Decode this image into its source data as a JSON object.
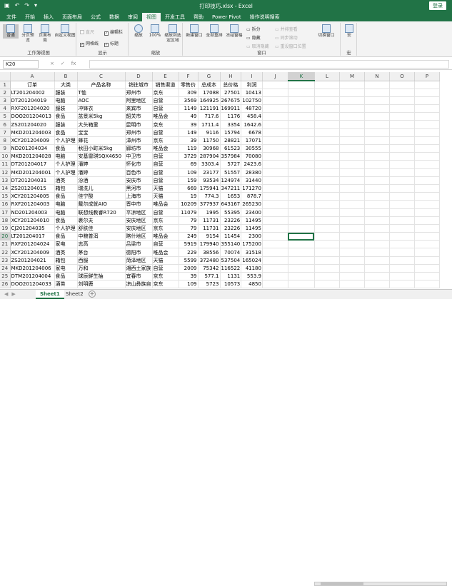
{
  "window": {
    "title": "打印技巧.xlsx - Excel",
    "login": "登录"
  },
  "menu": {
    "tabs": [
      "文件",
      "开始",
      "插入",
      "页面布局",
      "公式",
      "数据",
      "审阅",
      "视图",
      "开发工具",
      "帮助",
      "Power Pivot",
      "操作说明搜索"
    ],
    "active": 7
  },
  "ribbon": {
    "views": {
      "normal": "普通",
      "page_break": "分页预览",
      "page_layout": "页面布局",
      "custom": "自定义视图",
      "label": "工作簿视图"
    },
    "show": {
      "ruler": "直尺",
      "formula_bar": "编辑栏",
      "gridlines": "网格线",
      "headings": "标题",
      "label": "显示"
    },
    "zoom": {
      "zoom": "缩放",
      "zoom100": "100%",
      "zoom_sel": "缩放到选定区域",
      "label": "缩放"
    },
    "window": {
      "new": "新建窗口",
      "arrange": "全部重排",
      "freeze": "冻结窗格",
      "split": "拆分",
      "hide": "隐藏",
      "unhide": "取消隐藏",
      "side": "并排查看",
      "sync": "同步滚动",
      "reset": "重设窗口位置",
      "switch": "切换窗口",
      "label": "窗口"
    },
    "macro": {
      "macro": "宏",
      "label": "宏"
    }
  },
  "formula": {
    "namebox": "K20",
    "cancel": "×",
    "enter": "✓",
    "fx": "fx",
    "value": ""
  },
  "grid": {
    "columns": [
      "A",
      "B",
      "C",
      "D",
      "E",
      "F",
      "G",
      "H",
      "I",
      "J",
      "K",
      "L",
      "M",
      "N",
      "O",
      "P"
    ],
    "selected_cell": "K20",
    "rows": [
      [
        "订单",
        "大类",
        "产品名称",
        "销往城市",
        "销售渠道",
        "零售价",
        "总成本",
        "总价格",
        "利润"
      ],
      [
        "LT201204002",
        "服装",
        "T恤",
        "郑州市",
        "京东",
        "309",
        "17088",
        "27501",
        "10413"
      ],
      [
        "DT201204019",
        "电脑",
        "AOC",
        "阿里地区",
        "自营",
        "3569",
        "164925",
        "267675",
        "102750"
      ],
      [
        "RXF201204020",
        "服装",
        "冲锋衣",
        "来宾市",
        "自营",
        "1149",
        "121191",
        "169911",
        "48720"
      ],
      [
        "DOO201204013",
        "食品",
        "盆景米5kg",
        "韶关市",
        "唯品会",
        "49",
        "717.6",
        "1176",
        "458.4"
      ],
      [
        "ZS201204020",
        "服装",
        "大头箱里",
        "昆明市",
        "京东",
        "39",
        "1711.4",
        "3354",
        "1642.6"
      ],
      [
        "MKD201204003",
        "食品",
        "宝宝",
        "郑州市",
        "自营",
        "149",
        "9116",
        "15794",
        "6678"
      ],
      [
        "XCY201204009",
        "个人护理",
        "蜂花",
        "漳州市",
        "京东",
        "39",
        "11750",
        "28821",
        "17071"
      ],
      [
        "ND201204034",
        "食品",
        "秋田小町米5kg",
        "廊坊市",
        "唯品会",
        "119",
        "30968",
        "61523",
        "30555"
      ],
      [
        "MKD201204028",
        "电脑",
        "安基雷琪SQX4650",
        "中卫市",
        "自营",
        "3729",
        "287904",
        "357984",
        "70080"
      ],
      [
        "DT201204017",
        "个人护理",
        "潘婷",
        "怀化市",
        "自营",
        "69",
        "3303.4",
        "5727",
        "2423.6"
      ],
      [
        "MKD201204001",
        "个人护理",
        "潘婷",
        "百色市",
        "自营",
        "109",
        "23177",
        "51557",
        "28380"
      ],
      [
        "DT201204031",
        "酒类",
        "汾酒",
        "安庆市",
        "自营",
        "159",
        "93534",
        "124974",
        "31440"
      ],
      [
        "ZS201204015",
        "箱包",
        "瑞洗儿",
        "黑河市",
        "天猫",
        "669",
        "175941",
        "347211",
        "171270"
      ],
      [
        "XCY201204005",
        "食品",
        "佳宁酸",
        "上海市",
        "天猫",
        "19",
        "774.3",
        "1653",
        "878.7"
      ],
      [
        "RXF201204003",
        "电脑",
        "戴尔成就AIO",
        "晋中市",
        "唯品会",
        "10209",
        "377937",
        "643167",
        "265230"
      ],
      [
        "ND201204003",
        "电脑",
        "联想线教睿R720",
        "平凉地区",
        "自营",
        "11079",
        "1995",
        "55395",
        "23400"
      ],
      [
        "XCY201204010",
        "食品",
        "裹尔夫",
        "安庆地区",
        "京东",
        "79",
        "11731",
        "23226",
        "11495"
      ],
      [
        "CJ201204035",
        "个人护理",
        "舒肤佳",
        "安庆地区",
        "京东",
        "79",
        "11731",
        "23226",
        "11495"
      ],
      [
        "LT201204017",
        "食品",
        "中粮普洱",
        "喀什地区",
        "唯品会",
        "249",
        "9154",
        "11454",
        "2300"
      ],
      [
        "RXF201204024",
        "家电",
        "志高",
        "吕梁市",
        "自营",
        "5919",
        "179940",
        "355140",
        "175200"
      ],
      [
        "XCY201204009",
        "酒类",
        "茅台",
        "德阳市",
        "唯品会",
        "229",
        "38556",
        "70074",
        "31518"
      ],
      [
        "ZS201204021",
        "箱包",
        "西服",
        "菏泽地区",
        "天猫",
        "5599",
        "372480",
        "537504",
        "165024"
      ],
      [
        "MKD201204006",
        "家电",
        "万和",
        "湘西土家族",
        "自营",
        "2009",
        "75342",
        "116522",
        "41180"
      ],
      [
        "DTM201204004",
        "食品",
        "球辰鲜生抽",
        "宜春市",
        "京东",
        "39",
        "577.1",
        "1131",
        "553.9"
      ],
      [
        "DOO201204033",
        "酒类",
        "刘明鹿",
        "凉山彝族自",
        "京东",
        "109",
        "5723",
        "10573",
        "4850"
      ],
      [
        "DT201204014",
        "酒类",
        "刘明鹿",
        "衢州市",
        "天猫",
        "479",
        "29665",
        "40175",
        "11610"
      ],
      [
        "RXF201204019",
        "个人护理",
        "花生宝",
        "吉安市",
        "自营",
        "99",
        "18872",
        "33363",
        "14491"
      ],
      [
        "ND201204009",
        "食品",
        "肉类豆干",
        "忻州市",
        "唯品会",
        "49",
        "1401.6",
        "3136",
        "1734.4"
      ],
      [
        "MKD201204013",
        "手机",
        "荣耀V9 6G",
        "襄樊市",
        "自营",
        "5219",
        "153843",
        "297483",
        "143640"
      ],
      [
        "ZS201204016",
        "箱包",
        "稻草人",
        "甘孜藏族自",
        "京东",
        "329",
        "13727",
        "17437",
        "3710"
      ]
    ]
  },
  "sheets": {
    "tabs": [
      "Sheet1",
      "Sheet2"
    ],
    "active": 0,
    "add": "+"
  }
}
